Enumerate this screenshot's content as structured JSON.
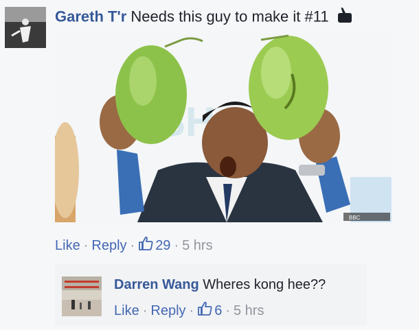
{
  "comment1": {
    "author": "Gareth T'r",
    "text": "Needs this guy to make it #11",
    "emoji_icon": "pointing-hand-icon",
    "actions": {
      "like": "Like",
      "reply": "Reply",
      "like_count": "29",
      "time": "5 hrs"
    },
    "photo": {
      "watermark": "BBC"
    }
  },
  "comment2": {
    "author": "Darren Wang",
    "text": "Wheres kong hee??",
    "actions": {
      "like": "Like",
      "reply": "Reply",
      "like_count": "6",
      "time": "5 hrs"
    }
  },
  "colors": {
    "name": "#365899",
    "link": "#4267b2",
    "meta": "#90949c",
    "background": "#f6f7f9"
  }
}
